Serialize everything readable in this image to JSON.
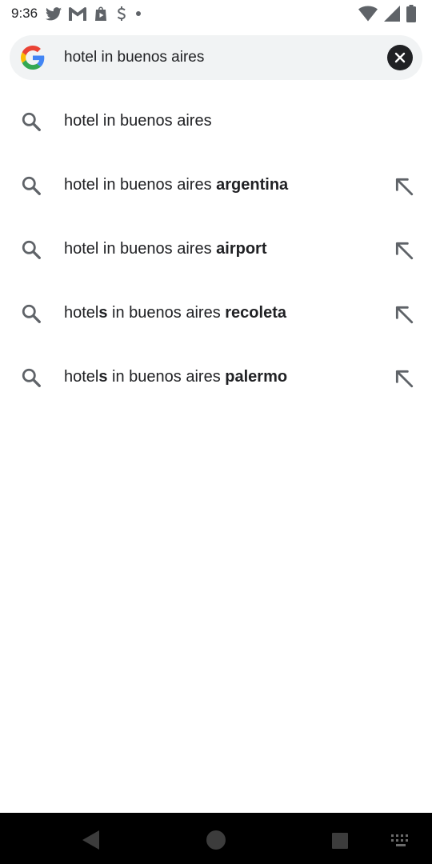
{
  "status_bar": {
    "time": "9:36",
    "left_icons": [
      "twitter-icon",
      "gmail-icon",
      "play-store-icon",
      "stripe-icon",
      "dot-icon"
    ],
    "right_icons": [
      "wifi-icon",
      "signal-icon",
      "battery-icon"
    ]
  },
  "search": {
    "query": "hotel in buenos aires",
    "logo": "google-g-icon",
    "clear_icon": "close-icon"
  },
  "suggestions": [
    {
      "prefix": "hotel in buenos aires",
      "bold": "",
      "has_arrow": false
    },
    {
      "prefix": "hotel in buenos aires ",
      "bold": "argentina",
      "has_arrow": true
    },
    {
      "prefix": "hotel in buenos aires ",
      "bold": "airport",
      "has_arrow": true
    },
    {
      "prefix_start": "hotel",
      "s": "s",
      "prefix": " in buenos aires ",
      "bold": "recoleta",
      "has_arrow": true
    },
    {
      "prefix_start": "hotel",
      "s": "s",
      "prefix": " in buenos aires ",
      "bold": "palermo",
      "has_arrow": true
    }
  ],
  "colors": {
    "search_bar_bg": "#f1f3f4",
    "text": "#202124",
    "icon_gray": "#5f6368",
    "nav_bg": "#000000"
  }
}
